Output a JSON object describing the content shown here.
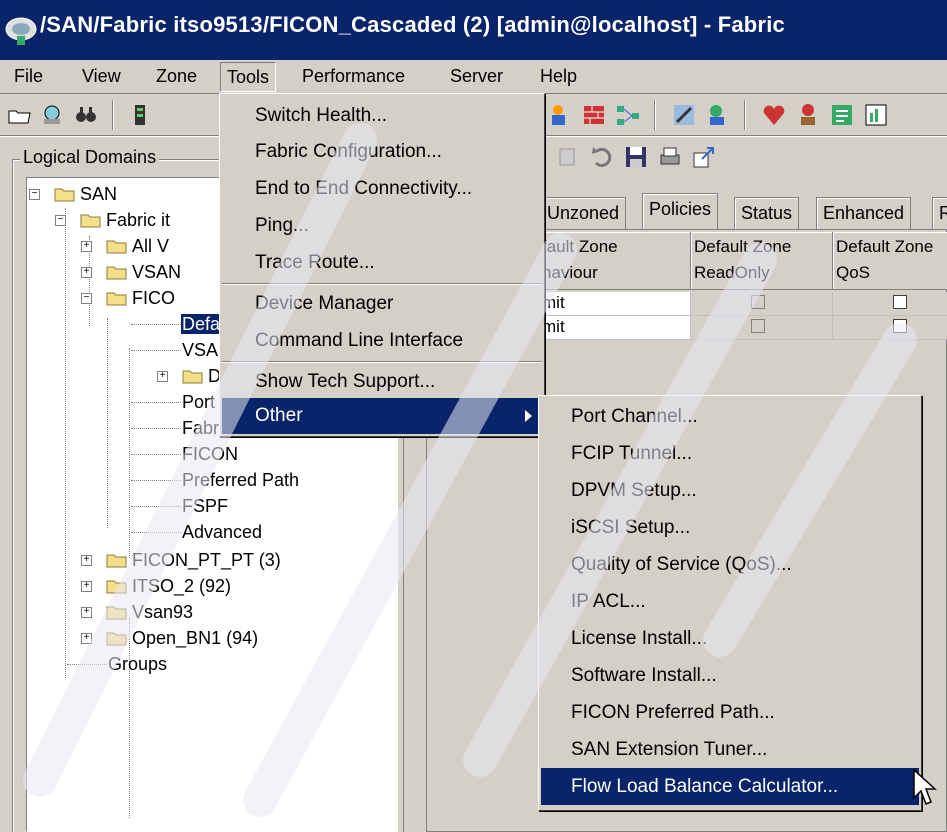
{
  "window": {
    "title": "/SAN/Fabric itso9513/FICON_Cascaded (2) [admin@localhost] - Fabric"
  },
  "menubar": {
    "items": [
      "File",
      "View",
      "Zone",
      "Tools",
      "Performance",
      "Server",
      "Help"
    ]
  },
  "tools_menu": {
    "items": [
      "Switch Health...",
      "Fabric Configuration...",
      "End to End Connectivity...",
      "Ping...",
      "Trace Route...",
      "Device Manager",
      "Command Line Interface",
      "Show Tech Support...",
      "Other"
    ]
  },
  "other_submenu": {
    "items": [
      "Port Channel...",
      "FCIP Tunnel...",
      "DPVM Setup...",
      "iSCSI Setup...",
      "Quality of Service (QoS)...",
      "IP ACL...",
      "License Install...",
      "Software Install...",
      "FICON Preferred Path...",
      "SAN Extension Tuner...",
      "Flow Load Balance Calculator..."
    ],
    "highlighted": "Flow Load Balance Calculator..."
  },
  "left_panel": {
    "title": "Logical Domains",
    "tree": [
      "SAN",
      "Fabric it",
      "All V",
      "VSAN",
      "FICO",
      "Defa",
      "VSAN",
      "D",
      "Port",
      "Fabric Binding",
      "FICON",
      "Preferred Path",
      "FSPF",
      "Advanced",
      "FICON_PT_PT (3)",
      "ITSO_2 (92)",
      "Vsan93",
      "Open_BN1 (94)",
      "Groups"
    ]
  },
  "right_panel": {
    "tabs": [
      "Unzoned",
      "Policies",
      "Status",
      "Enhanced",
      "R"
    ],
    "active_tab": "Policies",
    "columns": [
      [
        "fault Zone",
        "haviour"
      ],
      [
        "Default Zone",
        "ReadOnly"
      ],
      [
        "Default Zone",
        "QoS"
      ]
    ],
    "rows": [
      {
        "behaviour": "mit",
        "readonly": false,
        "qos": false
      },
      {
        "behaviour": "mit",
        "readonly": false,
        "qos": false
      }
    ]
  },
  "colors": {
    "selection": "#0a246a",
    "chrome": "#d4d0c8",
    "folder": "#f5e08a"
  }
}
